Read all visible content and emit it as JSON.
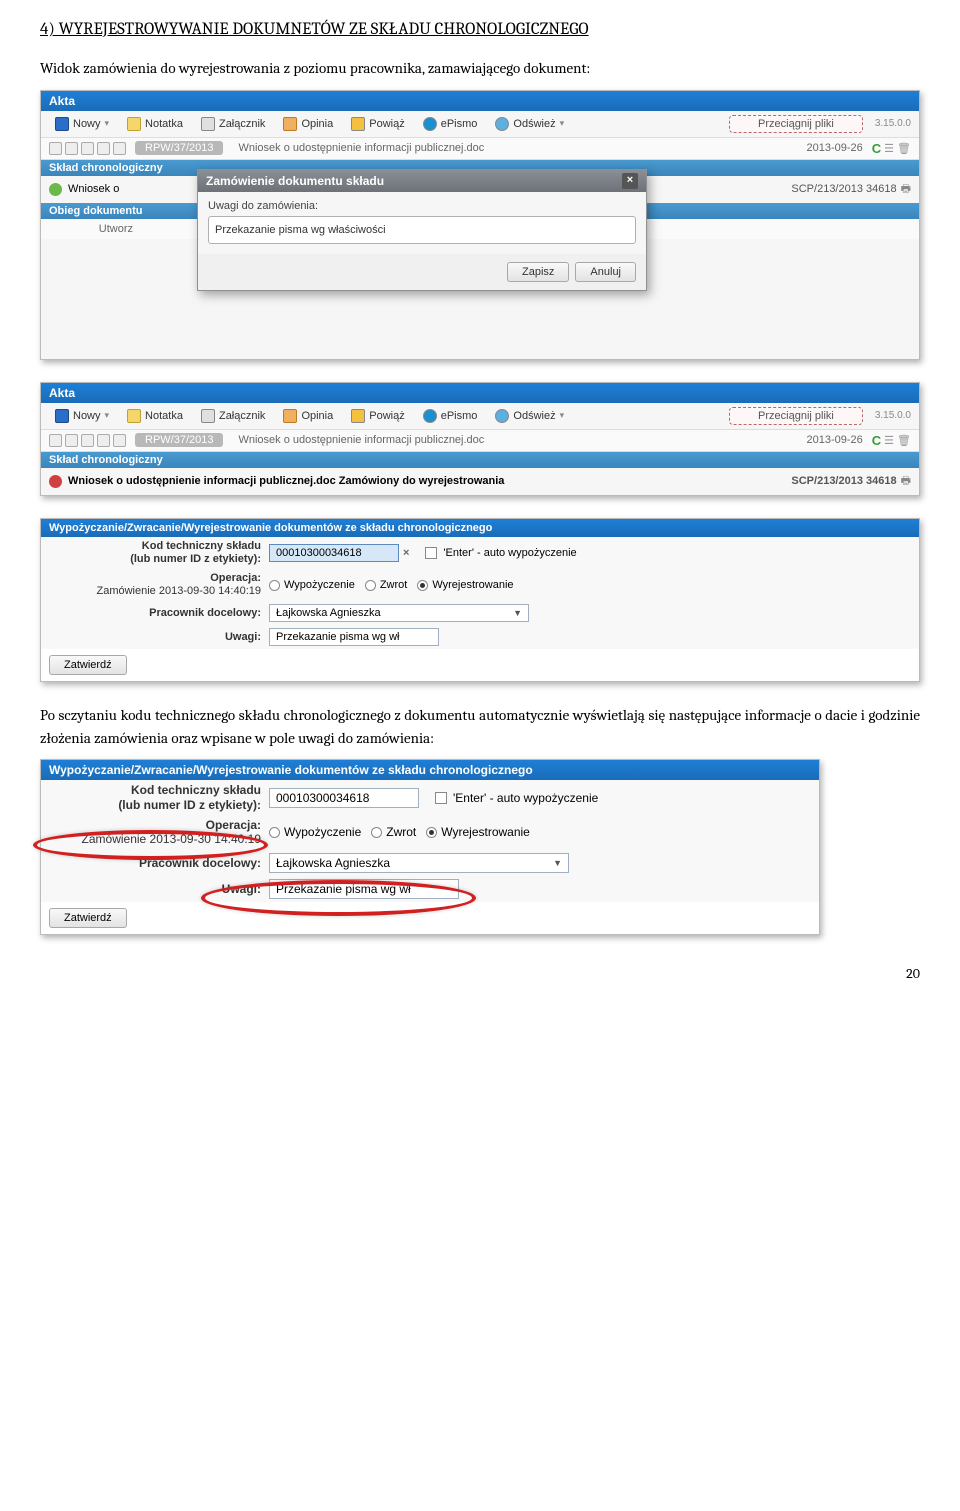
{
  "heading": "4) WYREJESTROWYWANIE  DOKUMNETÓW ZE SKŁADU CHRONOLOGICZNEGO",
  "intro": "Widok zamówienia do wyrejestrowania z poziomu pracownika, zamawiającego dokument:",
  "akta": {
    "title": "Akta",
    "toolbar": {
      "nowy": "Nowy",
      "notatka": "Notatka",
      "zalacznik": "Załącznik",
      "opinia": "Opinia",
      "powiaz": "Powiąż",
      "epismo": "ePismo",
      "odswiez": "Odśwież",
      "drag": "Przeciągnij pliki",
      "ver": "3.15.0.0"
    },
    "row": {
      "rpw": "RPW/37/2013",
      "file": "Wniosek o udostępnienie informacji publicznej.doc",
      "date": "2013-09-26"
    },
    "sklad_title": "Skład chronologiczny",
    "sklad1": {
      "label": "Wniosek o",
      "scp": "SCP/213/2013 34618"
    },
    "obieg_title": "Obieg dokumentu",
    "utworz": "Utworz"
  },
  "modal": {
    "title": "Zamówienie dokumentu składu",
    "label": "Uwagi do zamówienia:",
    "value": "Przekazanie pisma wg właściwości",
    "save": "Zapisz",
    "cancel": "Anuluj"
  },
  "akta2": {
    "sklad_text": "Wniosek o udostępnienie informacji publicznej.doc  Zamówiony do wyrejestrowania",
    "scp": "SCP/213/2013 34618"
  },
  "form": {
    "title": "Wypożyczanie/Zwracanie/Wyrejestrowanie dokumentów ze składu chronologicznego",
    "kod_label": "Kod techniczny składu\n(lub numer ID z etykiety):",
    "kod_value": "00010300034618",
    "enter_hint": "'Enter' - auto wypożyczenie",
    "operacja_label": "Operacja:",
    "zamowienie": "Zamówienie 2013-09-30 14:40:19",
    "r1": "Wypożyczenie",
    "r2": "Zwrot",
    "r3": "Wyrejestrowanie",
    "pracownik_label": "Pracownik docelowy:",
    "pracownik_value": "Łajkowska Agnieszka",
    "uwagi_label": "Uwagi:",
    "uwagi_value": "Przekazanie pisma wg wł",
    "submit": "Zatwierdź"
  },
  "mid_text": "Po sczytaniu kodu technicznego składu chronologicznego z dokumentu automatycznie wyświetlają się następujące informacje o dacie i godzinie złożenia zamówienia oraz wpisane w pole uwagi do zamówienia:",
  "pagenum": "20"
}
